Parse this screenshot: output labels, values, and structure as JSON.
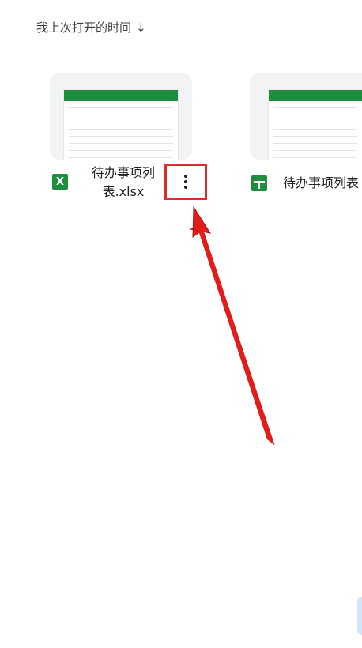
{
  "sort_header": {
    "label": "我上次打开的时间",
    "icon": "arrow-down-icon",
    "arrow_glyph": "↓"
  },
  "files": [
    {
      "name_line1": "待办事项列",
      "name_line2": "表.xlsx",
      "type_icon": "excel-icon",
      "type_glyph": "X"
    },
    {
      "name": "待办事项列表",
      "type_icon": "sheets-icon"
    }
  ],
  "colors": {
    "sheet_green": "#1e8e3e",
    "highlight_red": "#e02b2b",
    "arrow_red": "#e21b1b"
  }
}
